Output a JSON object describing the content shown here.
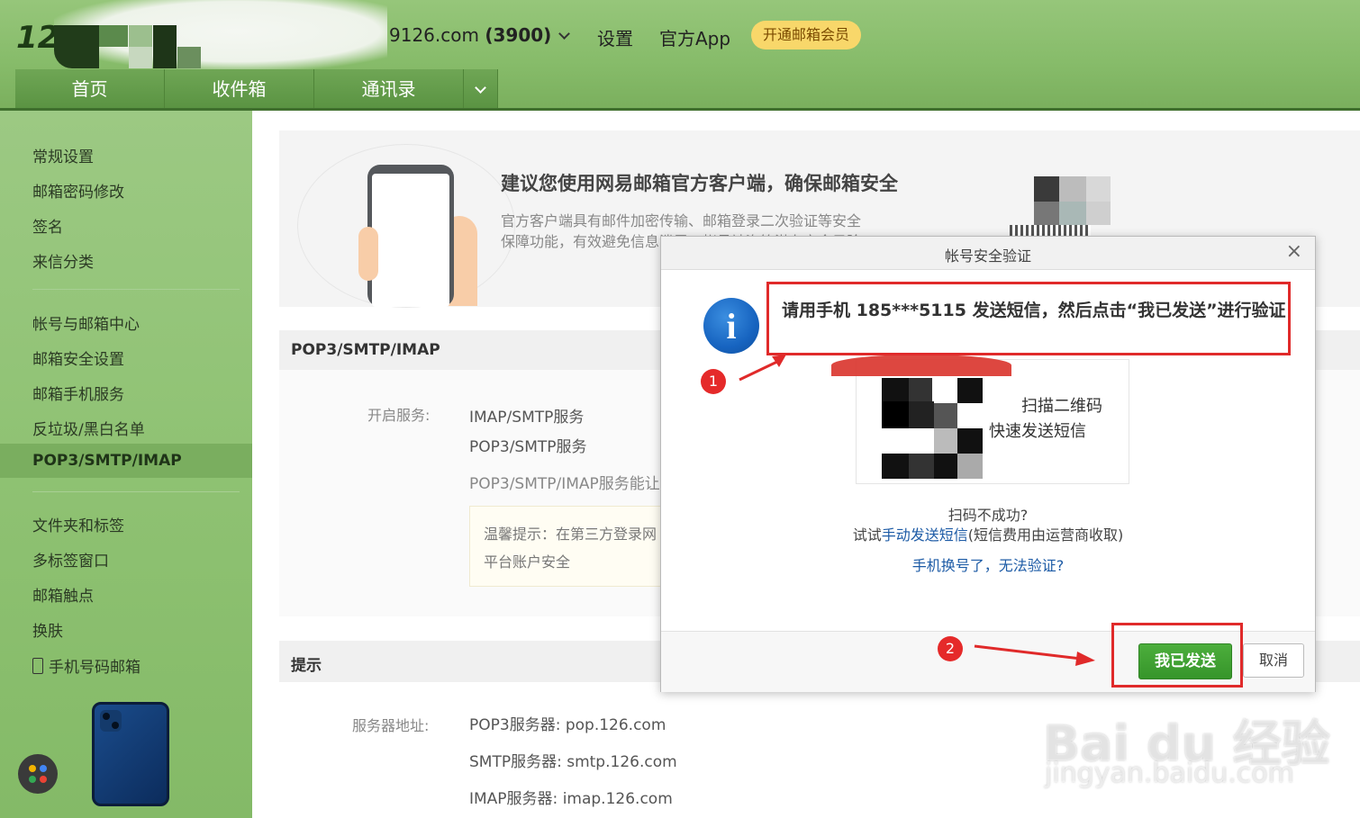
{
  "header": {
    "logo": "12",
    "account_prefix": "9126.com",
    "account_count": "(3900)",
    "settings": "设置",
    "official_app": "官方App",
    "vip": "开通邮箱会员",
    "tabs": [
      "首页",
      "收件箱",
      "通讯录"
    ]
  },
  "sidebar": {
    "group1": [
      "常规设置",
      "邮箱密码修改",
      "签名",
      "来信分类"
    ],
    "group2": [
      "帐号与邮箱中心",
      "邮箱安全设置",
      "邮箱手机服务",
      "反垃圾/黑白名单"
    ],
    "active": "POP3/SMTP/IMAP",
    "group3": [
      "文件夹和标签",
      "多标签窗口",
      "邮箱触点",
      "换肤"
    ],
    "phone_mail": "手机号码邮箱"
  },
  "promo": {
    "title": "建议您使用网易邮箱官方客户端，确保邮箱安全",
    "desc1": "官方客户端具有邮件加密传输、邮箱登录二次验证等安全",
    "desc2": "保障功能，有效避免信息泄露、帐号被盗等潜在安全风险"
  },
  "pop_section": {
    "title": "POP3/SMTP/IMAP",
    "enable_label": "开启服务:",
    "service1": "IMAP/SMTP服务",
    "service2": "POP3/SMTP服务",
    "desc": "POP3/SMTP/IMAP服务能让",
    "tip1": "温馨提示：在第三方登录网",
    "tip2": "平台账户安全"
  },
  "hint_section": {
    "title": "提示",
    "server_label": "服务器地址:",
    "pop3": "POP3服务器: pop.126.com",
    "smtp": "SMTP服务器: smtp.126.com",
    "imap": "IMAP服务器: imap.126.com"
  },
  "dialog": {
    "title": "帐号安全验证",
    "close": "×",
    "info_glyph": "i",
    "message": "请用手机 185***5115 发送短信，然后点击“我已发送”进行验证",
    "qr_text1": "扫描二维码",
    "qr_text2": "快速发送短信",
    "scan_fail": "扫码不成功?",
    "try_prefix": "试试",
    "manual_link": "手动发送短信",
    "manual_suffix": "(短信费用由运营商收取)",
    "phone_changed": "手机换号了，无法验证?",
    "btn_sent": "我已发送",
    "btn_cancel": "取消"
  },
  "annotations": {
    "badge1": "1",
    "badge2": "2"
  },
  "watermark": {
    "line1": "Bai du 经验",
    "line2": "jingyan.baidu.com"
  },
  "colors": {
    "accent_green": "#4cae3c",
    "annotation_red": "#e02a2a",
    "link_blue": "#1d5ba6"
  }
}
